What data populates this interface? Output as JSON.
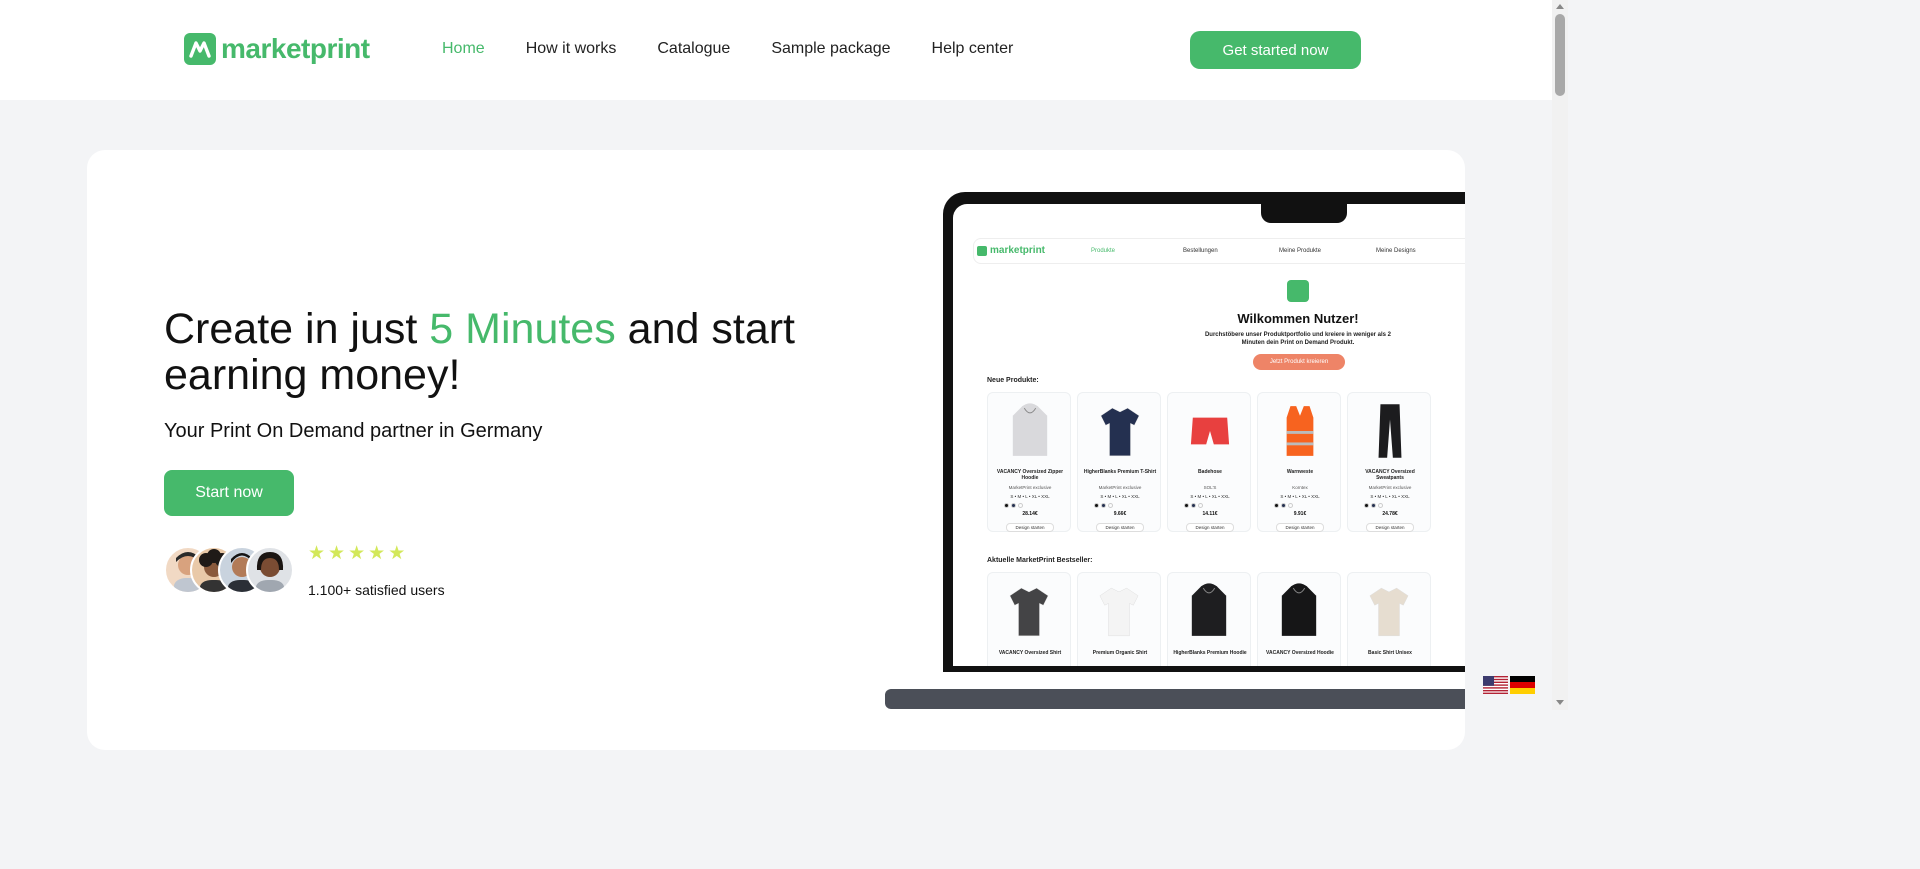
{
  "brand": {
    "name": "marketprint",
    "color": "#46b96b"
  },
  "nav": {
    "items": [
      {
        "label": "Home",
        "active": true
      },
      {
        "label": "How it works"
      },
      {
        "label": "Catalogue"
      },
      {
        "label": "Sample package"
      },
      {
        "label": "Help center"
      }
    ],
    "cta": "Get started now"
  },
  "hero": {
    "headline_before": "Create in just ",
    "headline_highlight": "5 Minutes",
    "headline_after": " and start earning money!",
    "subtitle": "Your Print On Demand partner in Germany",
    "button": "Start now",
    "rating": 5,
    "users_label": "1.100+ satisfied users"
  },
  "screen": {
    "logo": "marketprint",
    "nav": [
      "Produkte",
      "Bestellungen",
      "Meine Produkte",
      "Meine Designs"
    ],
    "welcome": "Wilkommen Nutzer!",
    "description": "Durchstöbere unser Produktportfolio und kreiere in weniger als 2 Minuten dein Print on Demand Produkt.",
    "create_button": "Jetzt Produkt kreieren",
    "new_title": "Neue Produkte:",
    "new_products": [
      {
        "name": "VACANCY Oversized Zipper Hoodie",
        "brand": "MarketPrint exclusive",
        "sizes": "S • M • L • XL • XXL",
        "price": "28.14€",
        "button": "Design starten",
        "color": "#d9d9dc"
      },
      {
        "name": "HigherBlanks Premium T-Shirt",
        "brand": "MarketPrint exclusive",
        "sizes": "S • M • L • XL • XXL",
        "price": "9.66€",
        "button": "Design starten",
        "color": "#243050"
      },
      {
        "name": "Badehose",
        "brand": "SOL'S",
        "sizes": "S • M • L • XL • XXL",
        "price": "14.11€",
        "button": "Design starten",
        "color": "#e8403f"
      },
      {
        "name": "Warnweste",
        "brand": "Korntex",
        "sizes": "S • M • L • XL • XXL",
        "price": "9.91€",
        "button": "Design starten",
        "color": "#f7631f"
      },
      {
        "name": "VACANCY Oversized Sweatpants",
        "brand": "MarketPrint exclusive",
        "sizes": "S • M • L • XL • XXL",
        "price": "24.78€",
        "button": "Design starten",
        "color": "#1c1c1e"
      }
    ],
    "best_title": "Aktuelle MarketPrint Bestseller:",
    "bestsellers": [
      {
        "name": "VACANCY Oversized Shirt",
        "color": "#444446"
      },
      {
        "name": "Premium Organic Shirt",
        "color": "#f4f4f4"
      },
      {
        "name": "HigherBlanks Premium Hoodie",
        "color": "#1e1e20"
      },
      {
        "name": "VACANCY Oversized Hoodie",
        "color": "#161617"
      },
      {
        "name": "Basic Shirt Unisex",
        "color": "#e6ddd0"
      }
    ]
  }
}
